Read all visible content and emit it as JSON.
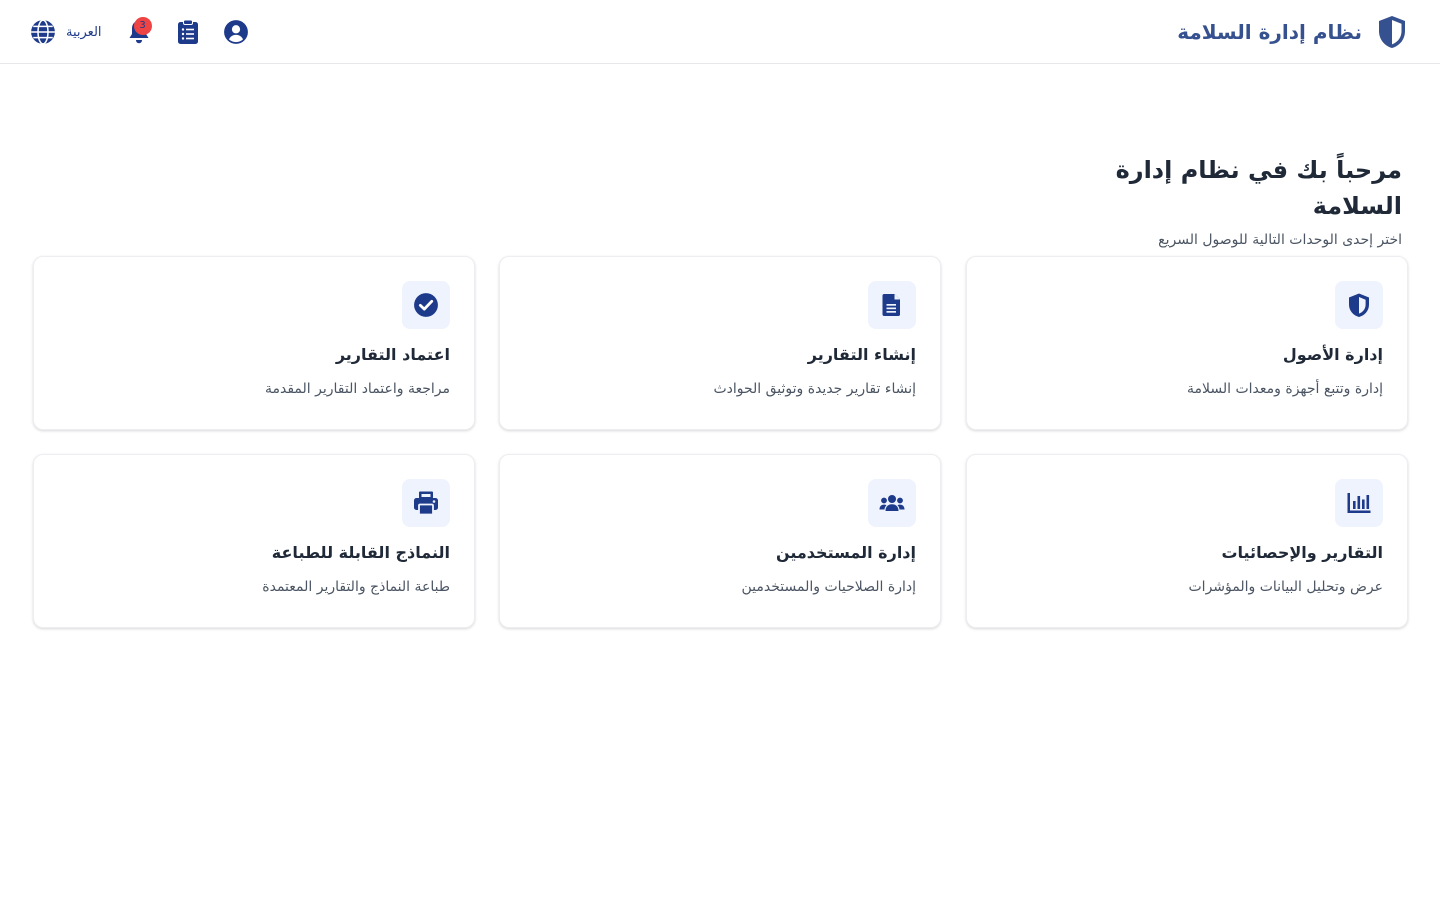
{
  "app": {
    "title": "نظام إدارة السلامة",
    "brand_color": "#36518f"
  },
  "header": {
    "language_label": "العربية",
    "notification_count": "3",
    "icons": [
      "globe-icon",
      "bell-icon",
      "clipboard-icon",
      "user-circle-icon",
      "shield-icon"
    ]
  },
  "welcome": {
    "title": "مرحباً بك في نظام إدارة السلامة",
    "subtitle": "اختر إحدى الوحدات التالية للوصول السريع"
  },
  "cards": [
    {
      "title": "إدارة الأصول",
      "description": "إدارة وتتبع أجهزة ومعدات السلامة",
      "icon": "shield-icon"
    },
    {
      "title": "إنشاء التقارير",
      "description": "إنشاء تقارير جديدة وتوثيق الحوادث",
      "icon": "file-text-icon"
    },
    {
      "title": "اعتماد التقارير",
      "description": "مراجعة واعتماد التقارير المقدمة",
      "icon": "check-circle-icon"
    },
    {
      "title": "التقارير والإحصائيات",
      "description": "عرض وتحليل البيانات والمؤشرات",
      "icon": "bar-chart-icon"
    },
    {
      "title": "إدارة المستخدمين",
      "description": "إدارة الصلاحيات والمستخدمين",
      "icon": "users-icon"
    },
    {
      "title": "النماذج القابلة للطباعة",
      "description": "طباعة النماذج والتقارير المعتمدة",
      "icon": "printer-icon"
    }
  ],
  "colors": {
    "accent": "#1e3a8a",
    "icon_bg": "#eef3fd",
    "badge": "#ef4444"
  }
}
